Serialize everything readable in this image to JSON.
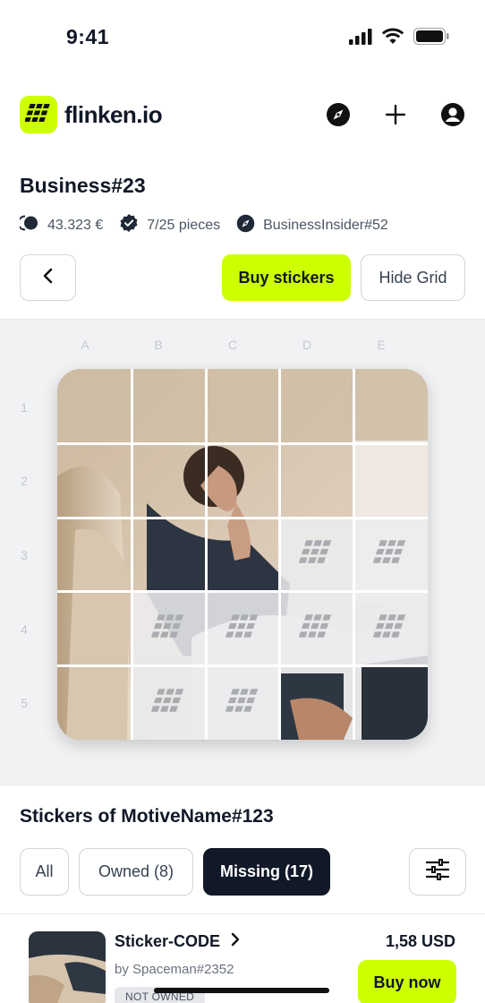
{
  "status": {
    "time": "9:41",
    "icons": [
      "signal-icon",
      "wifi-icon",
      "battery-icon"
    ]
  },
  "header": {
    "logo_text": "flinken.io",
    "icons": [
      "compass-icon",
      "plus-icon",
      "account-icon"
    ]
  },
  "motive": {
    "title": "Business#23",
    "value": "43.323 €",
    "pieces": "7/25 pieces",
    "owner": "BusinessInsider#52"
  },
  "actions": {
    "buy_stickers": "Buy stickers",
    "hide_grid": "Hide Grid"
  },
  "grid": {
    "columns": [
      "A",
      "B",
      "C",
      "D",
      "E"
    ],
    "rows": [
      "1",
      "2",
      "3",
      "4",
      "5"
    ]
  },
  "stickers": {
    "section_title": "Stickers of MotiveName#123",
    "filters": {
      "all": "All",
      "owned": "Owned (8)",
      "missing": "Missing (17)"
    },
    "items": [
      {
        "name": "Sticker-CODE",
        "owner": "by Spaceman#2352",
        "badge": "NOT OWNED",
        "price": "1,58 USD",
        "buy_label": "Buy now"
      }
    ]
  },
  "colors": {
    "accent": "#CCFF00",
    "dark": "#111827",
    "grid_bg": "#F1F2F4"
  }
}
